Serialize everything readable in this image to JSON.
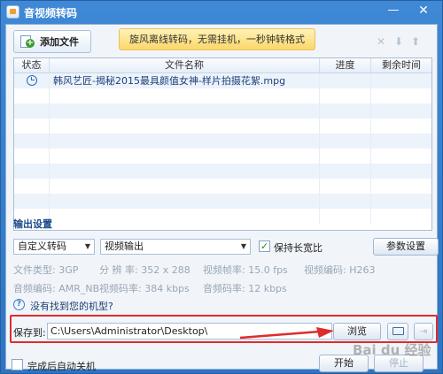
{
  "window": {
    "title": "音视频转码",
    "minimize_symbol": "—",
    "close_symbol": "✕"
  },
  "toolbar": {
    "add_file_label": "添加文件",
    "promo_text": "旋风离线转码，无需挂机，一秒钟转格式",
    "icons": [
      "delete-icon",
      "move-down-icon",
      "move-up-icon"
    ],
    "delete_symbol": "✕",
    "down_symbol": "⬇",
    "up_symbol": "⬆"
  },
  "file_table": {
    "columns": [
      "状态",
      "文件名称",
      "进度",
      "剩余时间"
    ],
    "rows": [
      {
        "status_icon": "clock-icon",
        "name": "韩风艺匠-揭秘2015最具颜值女神-样片拍摄花絮.mpg",
        "progress": "",
        "remaining": ""
      }
    ]
  },
  "output_settings": {
    "title": "输出设置",
    "convert_mode": "自定义转码",
    "output_type": "视频输出",
    "keep_ratio_label": "保持长宽比",
    "keep_ratio_checked": true,
    "params_button": "参数设置",
    "params": {
      "file_type": "文件类型:  3GP",
      "resolution": "分 辨 率:   352 x 288",
      "video_fps": "视频帧率:   15.0 fps",
      "video_codec": "视频编码:   H263",
      "audio_codec": "音频编码:   AMR_NB",
      "video_bitrate": "视频码率:   384 kbps",
      "audio_bitrate": "音频码率:   12 kbps"
    },
    "help_link": "没有找到您的机型?"
  },
  "save": {
    "label": "保存到:",
    "path": "C:\\Users\\Administrator\\Desktop\\",
    "browse_button": "浏览",
    "highlight_color": "#e02b2b"
  },
  "footer": {
    "shutdown_label": "完成后自动关机",
    "start_button": "开始",
    "stop_button": "停止",
    "watermark": "Bai du 经验"
  },
  "colors": {
    "title_bar": "#2f74c2",
    "promo_bg": "#fbd76a",
    "accent_red": "#e02b2b"
  }
}
